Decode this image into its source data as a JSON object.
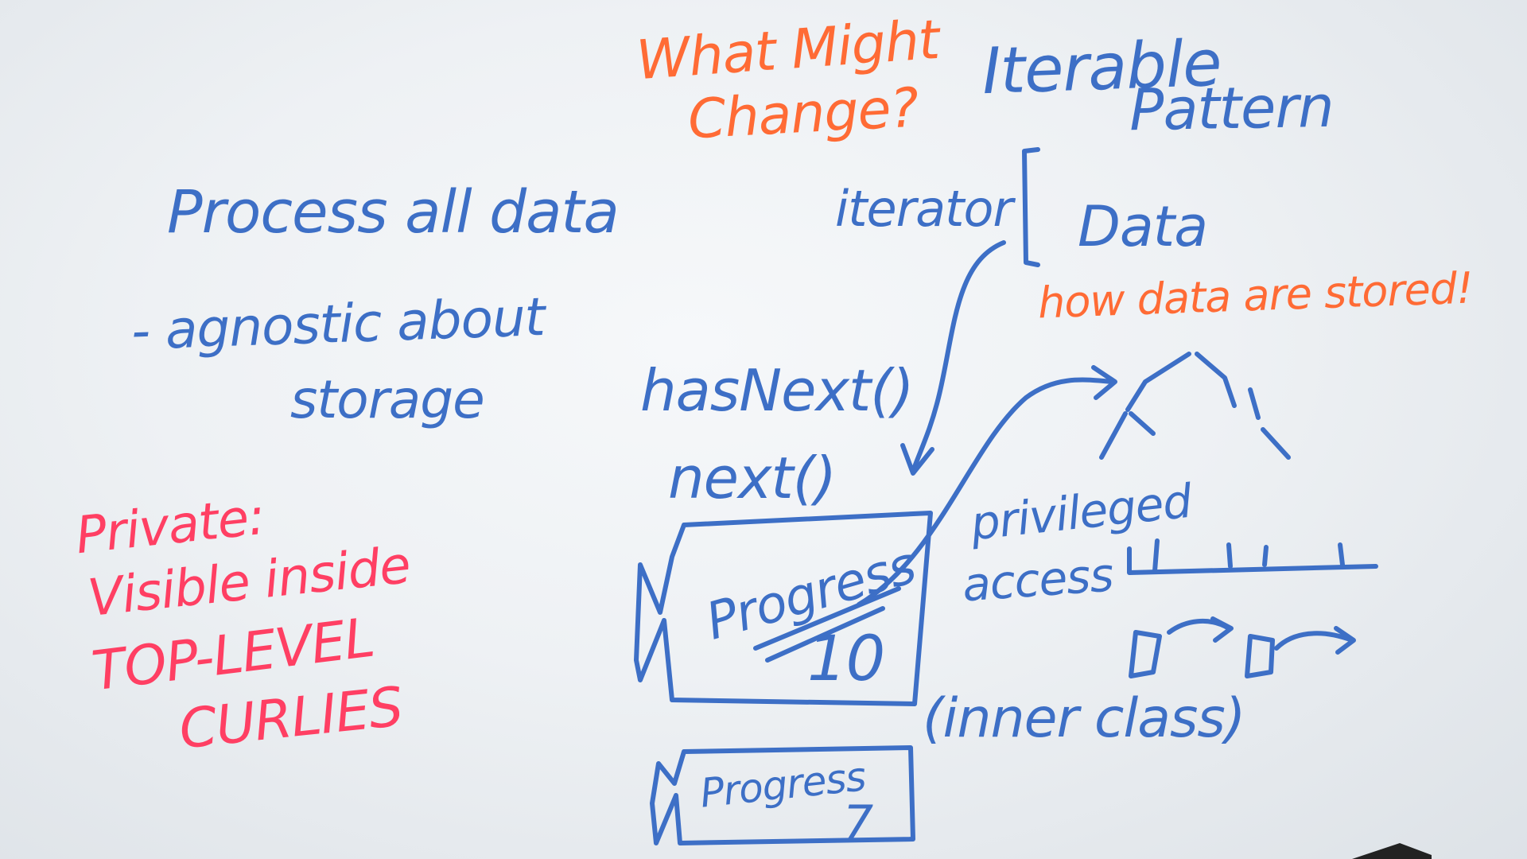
{
  "whiteboard": {
    "colors": {
      "blue_marker": "#3d6fc6",
      "orange_marker": "#ff6b35",
      "red_marker": "#ff3f63",
      "board": "#eef1f4"
    },
    "what_might_change": [
      "What Might",
      "Change?"
    ],
    "iterable_pattern": [
      "Iterable",
      "Pattern"
    ],
    "process_all_data": "Process all data",
    "agnostic": [
      "- agnostic about",
      "storage"
    ],
    "private_note": [
      "Private:",
      "Visible inside",
      "TOP-LEVEL",
      "CURLIES"
    ],
    "iterator_label": "iterator",
    "data_label": "Data",
    "how_data_stored": "how data are stored!",
    "has_next": "hasNext()",
    "next": "next()",
    "privileged_access": [
      "privileged",
      "access"
    ],
    "inner_class": "(inner class)",
    "progress_box_1": {
      "title": "Progress",
      "value": "10"
    },
    "progress_box_2": {
      "title": "Progress",
      "value": "7"
    }
  }
}
